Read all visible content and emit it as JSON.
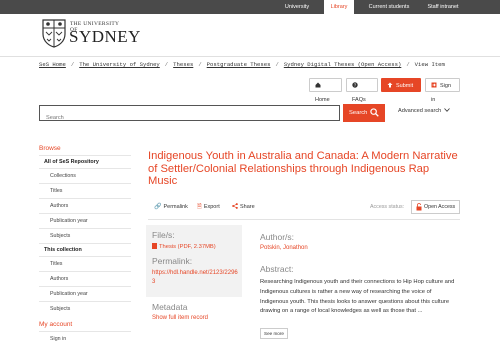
{
  "topnav": {
    "items": [
      {
        "label": "University"
      },
      {
        "label": "Library"
      },
      {
        "label": "Current students"
      },
      {
        "label": "Staff intranet"
      }
    ],
    "active_color": "#e64626"
  },
  "logo": {
    "line1": "THE UNIVERSITY OF",
    "line2": "SYDNEY"
  },
  "breadcrumb": {
    "items": [
      "SeS Home",
      "The University of Sydney",
      "Theses",
      "Postgraduate Theses",
      "Sydney Digital Theses (Open Access)"
    ],
    "current": "View Item"
  },
  "util": {
    "home": "Home",
    "faqs": "FAQs",
    "submit": "Submit",
    "signin": "Sign in"
  },
  "search": {
    "placeholder": "Search",
    "button": "Search",
    "advanced": "Advanced search"
  },
  "sidebar": {
    "browse": "Browse",
    "all_repo": "All of SeS Repository",
    "all_items": [
      "Collections",
      "Titles",
      "Authors",
      "Publication year",
      "Subjects"
    ],
    "this_collection": "This collection",
    "coll_items": [
      "Titles",
      "Authors",
      "Publication year",
      "Subjects"
    ],
    "my_account": "My account",
    "account_items": [
      "Sign in"
    ]
  },
  "item": {
    "title": "Indigenous Youth in Australia and Canada: A Modern Narrative of Settler/Colonial Relationships through Indigenous Rap Music",
    "actions": {
      "permalink": "Permalink",
      "export": "Export",
      "share": "Share"
    },
    "access_status_label": "Access status:",
    "access_status": "Open Access",
    "files_label": "File/s:",
    "file": "Thesis (PDF, 2.37MB)",
    "permalink_label": "Permalink:",
    "permalink": "https://hdl.handle.net/2123/22963",
    "metadata_label": "Metadata",
    "metadata_link": "Show full item record",
    "author_label": "Author/s:",
    "author": "Potskin, Jonathon",
    "abstract_label": "Abstract:",
    "abstract": "Researching Indigenous youth and their connections to Hip Hop culture and Indigenous cultures is rather a new way of researching the voice of Indigenous youth. This thesis looks to answer questions about this culture drawing on a range of local knowledges as well as those that ...",
    "see_more": "See more"
  },
  "colors": {
    "accent": "#e64626",
    "topbar": "#4a4a4a"
  }
}
